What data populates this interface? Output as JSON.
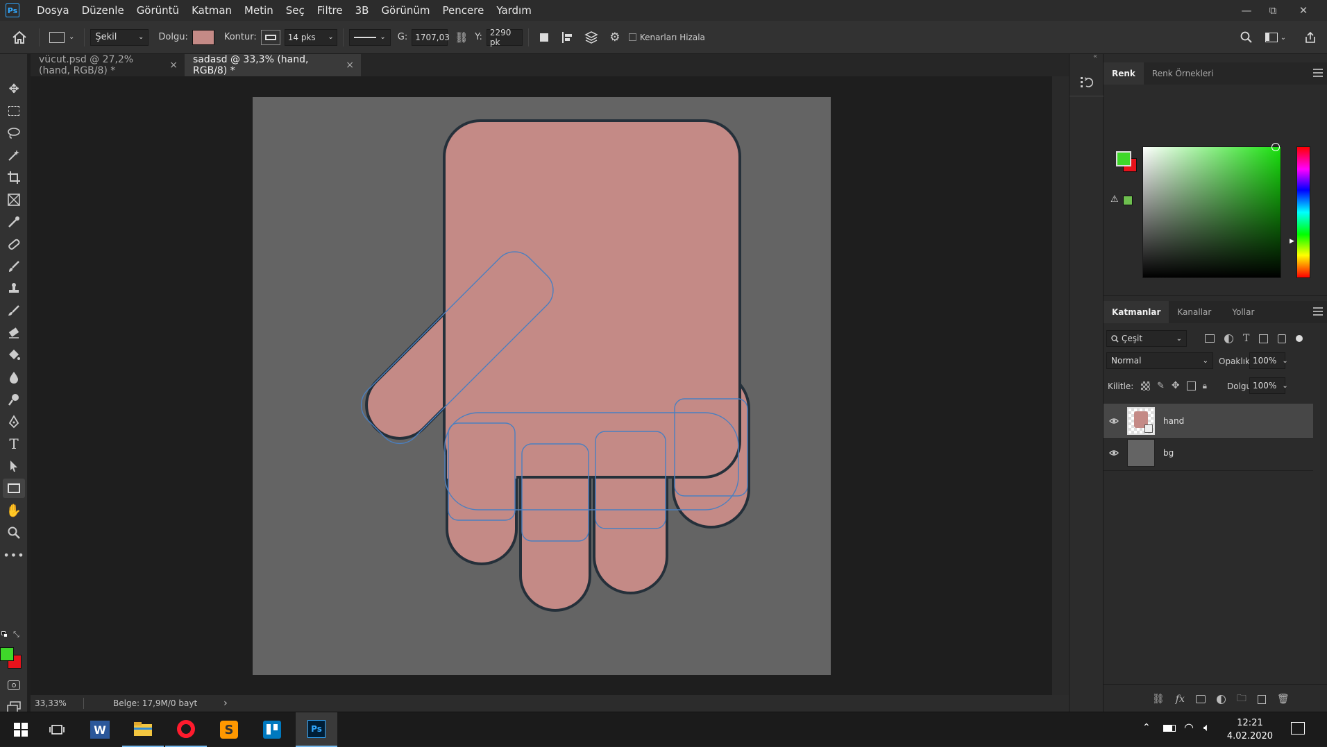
{
  "app": {
    "logo_text": "Ps"
  },
  "menu": [
    "Dosya",
    "Düzenle",
    "Görüntü",
    "Katman",
    "Metin",
    "Seç",
    "Filtre",
    "3B",
    "Görünüm",
    "Pencere",
    "Yardım"
  ],
  "window_controls": {
    "minimize": "—",
    "restore": "⧉",
    "close": "✕"
  },
  "options_bar": {
    "mode": "Şekil",
    "fill_label": "Dolgu:",
    "fill_color": "#c48a86",
    "stroke_label": "Kontur:",
    "stroke_size": "14 pks",
    "width_label": "G:",
    "width_value": "1707,03",
    "height_label": "Y:",
    "height_value": "2290 pk",
    "align_edges_label": "Kenarları Hizala"
  },
  "tabs": [
    {
      "label": "vücut.psd @ 27,2% (hand, RGB/8) *",
      "close": "×",
      "active": false
    },
    {
      "label": "sadasd @ 33,3% (hand, RGB/8) *",
      "close": "×",
      "active": true
    }
  ],
  "status": {
    "zoom": "33,33%",
    "doc_info": "Belge: 17,9M/0 bayt",
    "arrow": "›"
  },
  "color_panel": {
    "tabs": [
      "Renk",
      "Renk Örnekleri"
    ],
    "foreground": "#3fd82a",
    "background": "#e8121b",
    "web_safe_color": "#6ebf4f",
    "gradient_hue": "#19e00e"
  },
  "layers_panel": {
    "tabs": [
      "Katmanlar",
      "Kanallar",
      "Yollar"
    ],
    "filter_label": "Çeşit",
    "blend_mode": "Normal",
    "opacity_label": "Opaklık:",
    "opacity_value": "100%",
    "lock_label": "Kilitle:",
    "fill_label": "Dolgu:",
    "fill_value": "100%",
    "layers": [
      {
        "name": "hand",
        "selected": true,
        "thumb": "#c48a86"
      },
      {
        "name": "bg",
        "selected": false,
        "thumb": "#646464"
      }
    ]
  },
  "canvas": {
    "bg_color": "#646464",
    "hand_fill": "#c48a86",
    "outline_color": "#25303a",
    "path_color": "#4a7fc0"
  },
  "taskbar": {
    "time": "12:21",
    "date": "4.02.2020"
  }
}
